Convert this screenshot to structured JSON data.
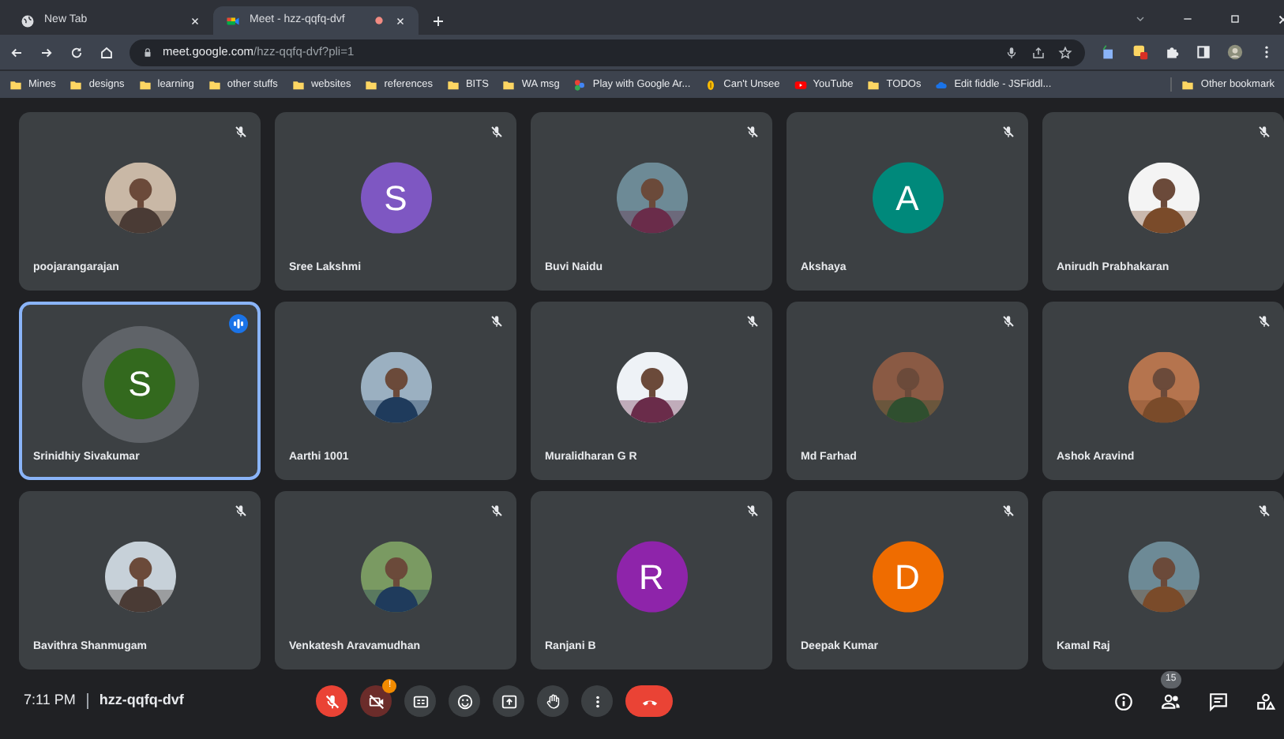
{
  "tabs": [
    {
      "label": "New Tab",
      "selected": false,
      "recording": false
    },
    {
      "label": "Meet - hzz-qqfq-dvf",
      "selected": true,
      "recording": true
    }
  ],
  "address": {
    "host": "meet.google.com",
    "path": "/hzz-qqfq-dvf?pli=1"
  },
  "bookmarks": [
    {
      "label": "Mines",
      "kind": "folder"
    },
    {
      "label": "designs",
      "kind": "folder"
    },
    {
      "label": "learning",
      "kind": "folder"
    },
    {
      "label": "other stuffs",
      "kind": "folder"
    },
    {
      "label": "websites",
      "kind": "folder"
    },
    {
      "label": "references",
      "kind": "folder"
    },
    {
      "label": "BITS",
      "kind": "folder"
    },
    {
      "label": "WA msg",
      "kind": "folder"
    },
    {
      "label": "Play with Google Ar...",
      "kind": "arts"
    },
    {
      "label": "Can't Unsee",
      "kind": "coin"
    },
    {
      "label": "YouTube",
      "kind": "youtube"
    },
    {
      "label": "TODOs",
      "kind": "folder"
    },
    {
      "label": "Edit fiddle - JSFiddl...",
      "kind": "cloud"
    }
  ],
  "other_bookmarks": "Other bookmark",
  "tiles": [
    {
      "name": "poojarangarajan",
      "kind": "picture",
      "speaking": false
    },
    {
      "name": "Sree Lakshmi",
      "kind": "letter",
      "letter": "S",
      "color": "#7e57c2",
      "speaking": false
    },
    {
      "name": "Buvi Naidu",
      "kind": "picture",
      "speaking": false
    },
    {
      "name": "Akshaya",
      "kind": "letter",
      "letter": "A",
      "color": "#00897b",
      "speaking": false
    },
    {
      "name": "Anirudh Prabhakaran",
      "kind": "picture",
      "speaking": false
    },
    {
      "name": "Srinidhiy Sivakumar",
      "kind": "letter",
      "letter": "S",
      "color": "#33691e",
      "speaking": true
    },
    {
      "name": "Aarthi 1001",
      "kind": "picture",
      "speaking": false
    },
    {
      "name": "Muralidharan G R",
      "kind": "picture",
      "speaking": false
    },
    {
      "name": "Md Farhad",
      "kind": "picture",
      "speaking": false
    },
    {
      "name": "Ashok Aravind",
      "kind": "picture",
      "speaking": false
    },
    {
      "name": "Bavithra Shanmugam",
      "kind": "picture",
      "speaking": false
    },
    {
      "name": "Venkatesh Aravamudhan",
      "kind": "picture",
      "speaking": false
    },
    {
      "name": "Ranjani B",
      "kind": "letter",
      "letter": "R",
      "color": "#8e24aa",
      "speaking": false
    },
    {
      "name": "Deepak Kumar",
      "kind": "letter",
      "letter": "D",
      "color": "#ef6c00",
      "speaking": false
    },
    {
      "name": "Kamal Raj",
      "kind": "picture",
      "speaking": false
    }
  ],
  "time": "7:11 PM",
  "meeting_code": "hzz-qqfq-dvf",
  "controls": [
    {
      "kind": "mic",
      "muted": true
    },
    {
      "kind": "camera",
      "muted": true,
      "badge": "!"
    },
    {
      "kind": "captions"
    },
    {
      "kind": "emoji"
    },
    {
      "kind": "present"
    },
    {
      "kind": "hand"
    },
    {
      "kind": "more"
    },
    {
      "kind": "end-call"
    }
  ],
  "side_controls": [
    {
      "kind": "info"
    },
    {
      "kind": "people",
      "badge": "15"
    },
    {
      "kind": "chat"
    },
    {
      "kind": "activities"
    }
  ]
}
